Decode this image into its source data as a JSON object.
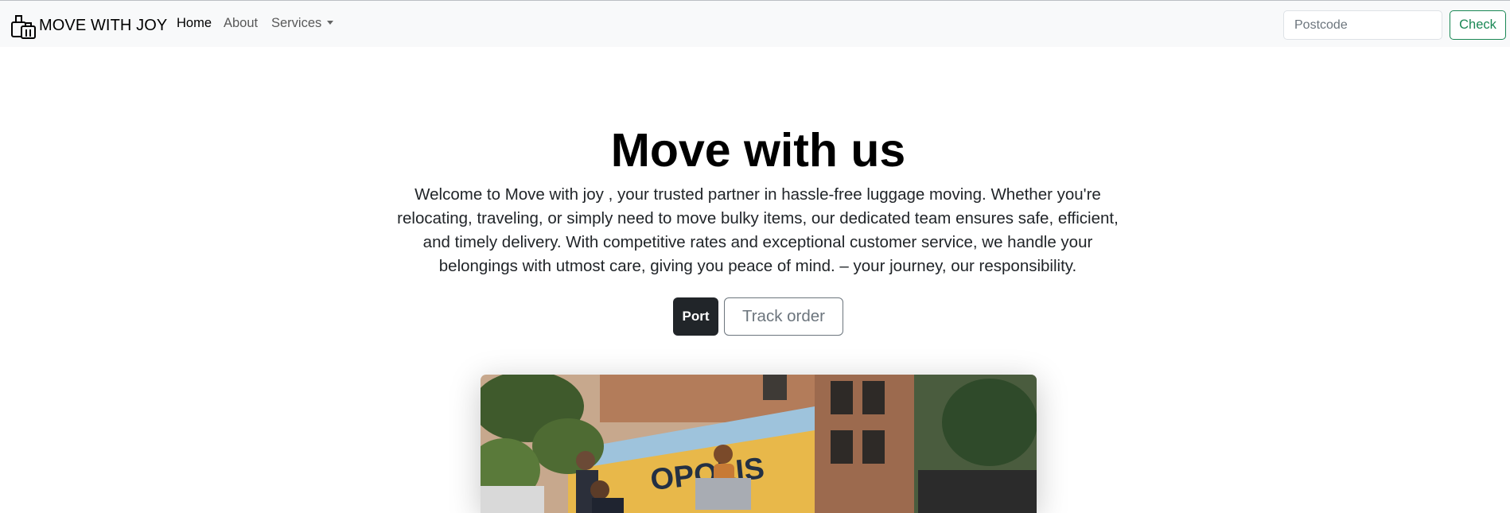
{
  "navbar": {
    "brand": {
      "text": "MOVE WITH JOY",
      "icon": "luggage-icon"
    },
    "links": [
      {
        "label": "Home",
        "active": true
      },
      {
        "label": "About",
        "active": false
      },
      {
        "label": "Services",
        "active": false,
        "dropdown": true
      }
    ],
    "search": {
      "placeholder": "Postcode",
      "value": "",
      "button_label": "Check"
    }
  },
  "hero": {
    "title": "Move with us",
    "description": "Welcome to Move with joy , your trusted partner in hassle-free luggage moving. Whether you're relocating, traveling, or simply need to move bulky items, our dedicated team ensures safe, efficient, and timely delivery. With competitive rates and exceptional customer service, we handle your belongings with utmost care, giving you peace of mind. – your journey, our responsibility.",
    "buttons": {
      "primary": "Port",
      "secondary": "Track order"
    },
    "image": {
      "truck_text": "OPOLIS"
    }
  },
  "colors": {
    "navbar_bg": "#f8f9fa",
    "check_green": "#198754",
    "dark_button": "#212529",
    "secondary_gray": "#6c757d"
  }
}
